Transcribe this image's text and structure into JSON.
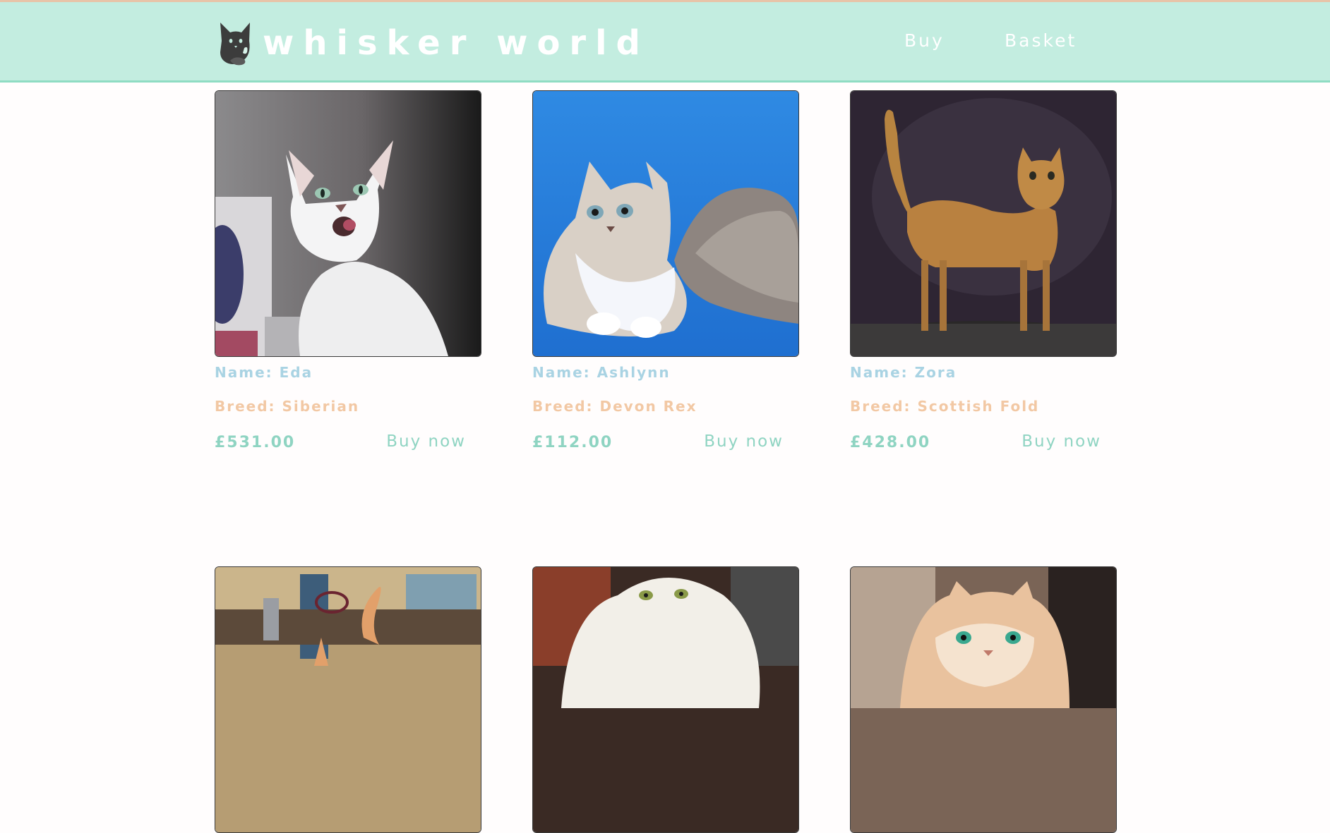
{
  "header": {
    "brand": "whisker world",
    "nav": {
      "buy": "Buy",
      "basket": "Basket"
    }
  },
  "colors": {
    "header_bg": "#c3ede0",
    "header_border": "#8fdcc3",
    "name_text": "#a9d3e3",
    "breed_text": "#f2c8a4",
    "price_text": "#8fd4c2"
  },
  "products": [
    {
      "name": "Name: Eda",
      "breed": "Breed: Siberian",
      "price": "£531.00",
      "buy_label": "Buy now"
    },
    {
      "name": "Name: Ashlynn",
      "breed": "Breed: Devon Rex",
      "price": "£112.00",
      "buy_label": "Buy now"
    },
    {
      "name": "Name: Zora",
      "breed": "Breed: Scottish Fold",
      "price": "£428.00",
      "buy_label": "Buy now"
    }
  ]
}
